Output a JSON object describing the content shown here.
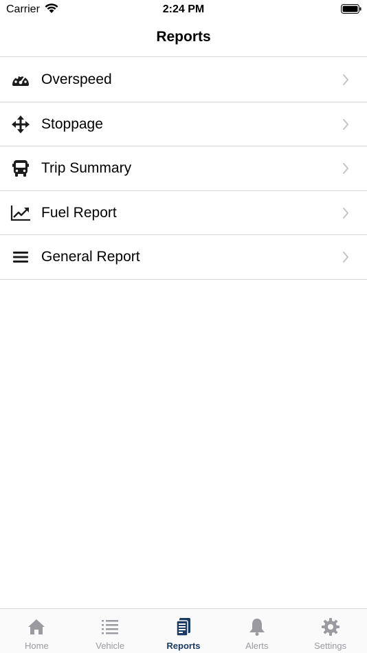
{
  "status_bar": {
    "carrier": "Carrier",
    "time": "2:24 PM"
  },
  "nav": {
    "title": "Reports"
  },
  "reports": [
    {
      "label": "Overspeed",
      "icon": "speedometer-icon"
    },
    {
      "label": "Stoppage",
      "icon": "move-arrows-icon"
    },
    {
      "label": "Trip Summary",
      "icon": "bus-icon"
    },
    {
      "label": "Fuel Report",
      "icon": "line-chart-icon"
    },
    {
      "label": "General Report",
      "icon": "menu-lines-icon"
    }
  ],
  "tabs": [
    {
      "label": "Home",
      "icon": "home-icon",
      "active": false
    },
    {
      "label": "Vehicle",
      "icon": "list-icon",
      "active": false
    },
    {
      "label": "Reports",
      "icon": "reports-icon",
      "active": true
    },
    {
      "label": "Alerts",
      "icon": "bell-icon",
      "active": false
    },
    {
      "label": "Settings",
      "icon": "gear-icon",
      "active": false
    }
  ],
  "colors": {
    "active_tab": "#1a3a63",
    "inactive_tab": "#9a9aa0",
    "separator": "#d8d8dc",
    "chevron": "#c4c4c7"
  }
}
